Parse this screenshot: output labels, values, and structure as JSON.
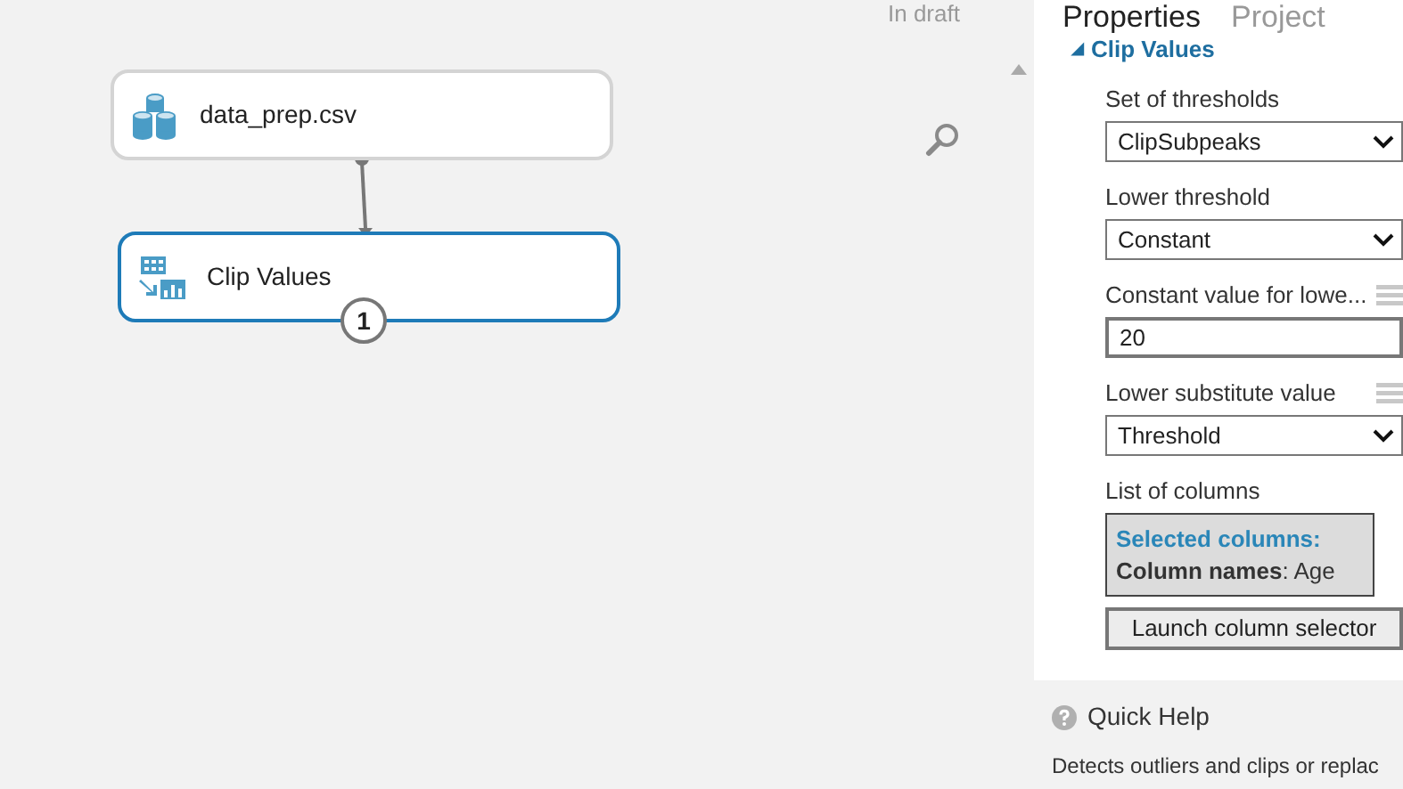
{
  "canvas": {
    "status": "In draft",
    "modules": [
      {
        "label": "data_prep.csv",
        "kind": "dataset",
        "selected": false
      },
      {
        "label": "Clip Values",
        "kind": "transform",
        "selected": true,
        "badge": "1"
      }
    ]
  },
  "panel": {
    "tabs": [
      {
        "label": "Properties",
        "selected": true
      },
      {
        "label": "Project",
        "selected": false
      }
    ],
    "section": {
      "toggle": "◢",
      "title": "Clip Values",
      "expanded": true
    },
    "fields": [
      {
        "kind": "select",
        "label": "Set of thresholds",
        "value": "ClipSubpeaks"
      },
      {
        "kind": "select",
        "label": "Lower threshold",
        "value": "Constant"
      },
      {
        "kind": "input",
        "label": "Constant value for lowe...",
        "value": "20",
        "parameter": true
      },
      {
        "kind": "select",
        "label": "Lower substitute value",
        "value": "Threshold",
        "parameter": true
      },
      {
        "kind": "columns",
        "label": "List of columns",
        "heading": "Selected columns:",
        "value": "**Column names**: Age",
        "button": "Launch column selector"
      }
    ]
  },
  "quick_help": {
    "title": "Quick Help",
    "text": "Detects outliers and clips or replac"
  }
}
